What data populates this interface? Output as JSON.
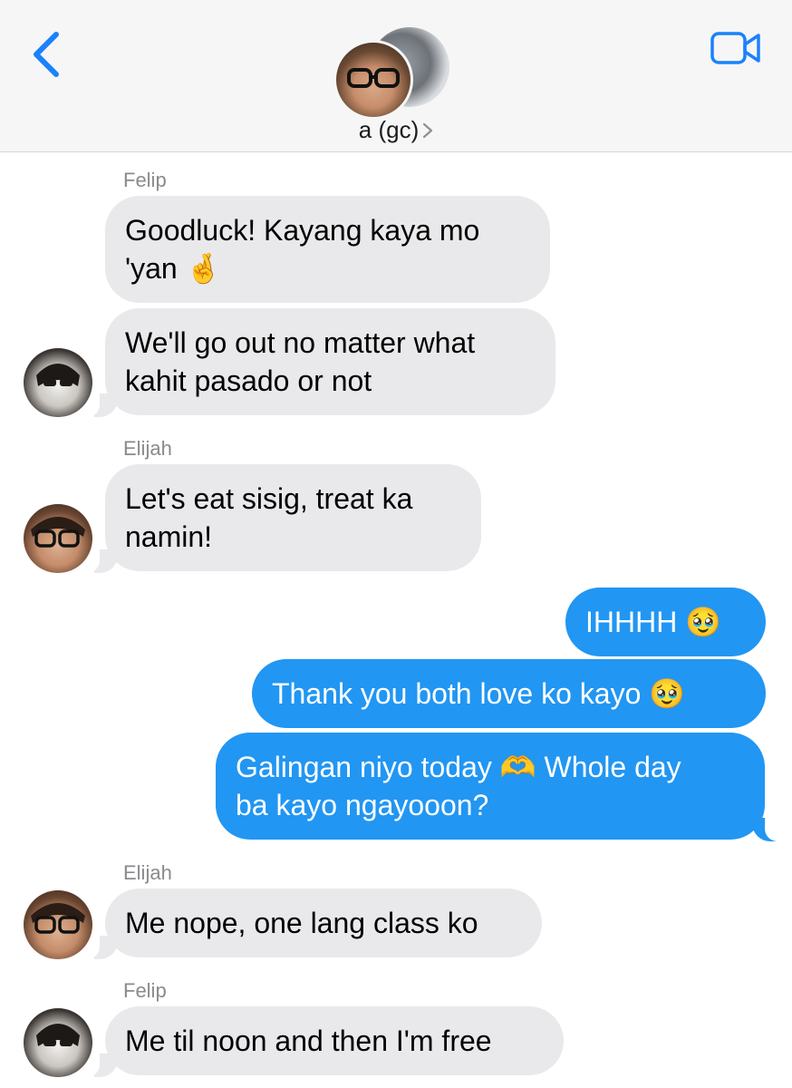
{
  "header": {
    "back_icon": "chevron-left-icon",
    "video_icon": "video-camera-icon",
    "title": "a (gc)",
    "title_chevron": ">",
    "accent_color": "#1a82fb"
  },
  "messages": [
    {
      "sender": "Felip",
      "direction": "incoming",
      "lines": [
        "Goodluck! Kayang kaya mo",
        "'yan 🤞"
      ]
    },
    {
      "sender": "",
      "direction": "incoming",
      "lines": [
        "We'll go out no matter what",
        "kahit pasado or not"
      ]
    },
    {
      "sender": "Elijah",
      "direction": "incoming",
      "lines": [
        "Let's eat sisig, treat ka",
        "namin!"
      ]
    },
    {
      "sender": "",
      "direction": "outgoing",
      "lines": [
        "IHHHH 🥹"
      ]
    },
    {
      "sender": "",
      "direction": "outgoing",
      "lines": [
        "Thank you both love ko kayo 🥹"
      ]
    },
    {
      "sender": "",
      "direction": "outgoing",
      "lines": [
        "Galingan niyo today 🫶 Whole day",
        "ba kayo ngayooon?"
      ]
    },
    {
      "sender": "Elijah",
      "direction": "incoming",
      "lines": [
        "Me nope, one lang class ko"
      ]
    },
    {
      "sender": "Felip",
      "direction": "incoming",
      "lines": [
        "Me til noon and then I'm free"
      ]
    }
  ],
  "colors": {
    "incoming_bubble": "#e9e9eb",
    "outgoing_bubble": "#2196f3",
    "header_bg": "#f6f6f7"
  }
}
